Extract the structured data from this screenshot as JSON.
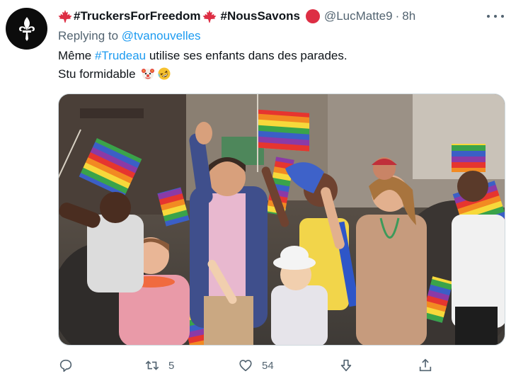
{
  "tweet": {
    "display_name_part1": "#TruckersForFreedom",
    "display_name_part2": "#NousSavons",
    "handle": "@LucMatte9",
    "separator": "·",
    "timestamp": "8h",
    "replying_prefix": "Replying to",
    "replying_to": "@tvanouvelles",
    "text_line1_before": "Même ",
    "text_hashtag": "#Trudeau",
    "text_line1_after": " utilise ses enfants dans des parades.",
    "text_line2": "Stu formidable",
    "emojis": [
      "clown-face-icon",
      "rolling-laughing-icon"
    ],
    "colors": {
      "text": "#0f1419",
      "secondary": "#536471",
      "link": "#1d9bf0",
      "border": "#cfd9de",
      "maple_leaf": "#dd2e44"
    }
  },
  "actions": {
    "reply_count": "",
    "retweet_count": "5",
    "like_count": "54"
  },
  "media": {
    "kind": "photo",
    "subject": "pride-parade-photo"
  }
}
